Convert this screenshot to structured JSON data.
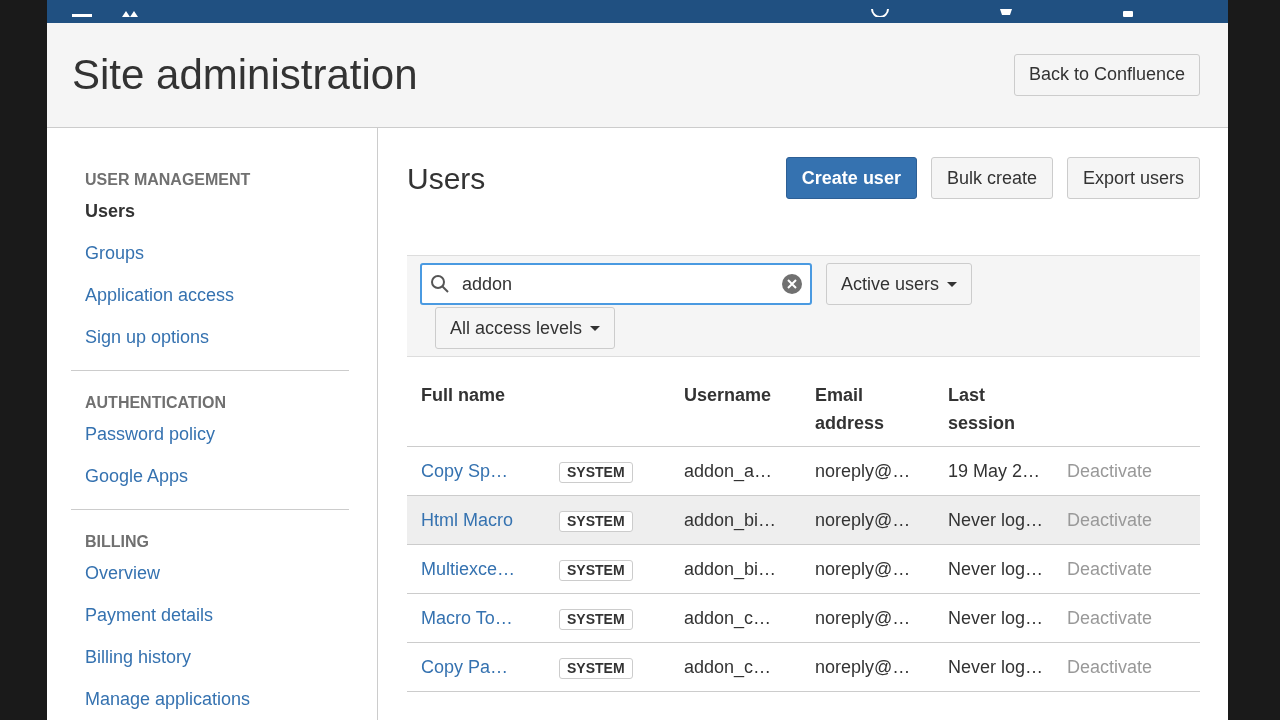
{
  "page_title": "Site administration",
  "back_button": "Back to Confluence",
  "sidebar": [
    {
      "heading": "USER MANAGEMENT",
      "items": [
        {
          "label": "Users",
          "selected": true
        },
        {
          "label": "Groups",
          "selected": false
        },
        {
          "label": "Application access",
          "selected": false
        },
        {
          "label": "Sign up options",
          "selected": false
        }
      ]
    },
    {
      "heading": "AUTHENTICATION",
      "items": [
        {
          "label": "Password policy",
          "selected": false
        },
        {
          "label": "Google Apps",
          "selected": false
        }
      ]
    },
    {
      "heading": "BILLING",
      "items": [
        {
          "label": "Overview",
          "selected": false
        },
        {
          "label": "Payment details",
          "selected": false
        },
        {
          "label": "Billing history",
          "selected": false
        },
        {
          "label": "Manage applications",
          "selected": false
        }
      ]
    }
  ],
  "section_title": "Users",
  "actions": [
    {
      "label": "Create user",
      "kind": "primary"
    },
    {
      "label": "Bulk create",
      "kind": "default"
    },
    {
      "label": "Export users",
      "kind": "default"
    }
  ],
  "search": {
    "value": "addon"
  },
  "filters": [
    "Active users",
    "All access levels"
  ],
  "table": {
    "columns": [
      "Full name",
      "",
      "Username",
      "Email address",
      "Last session",
      ""
    ],
    "rows": [
      {
        "name": "Copy Sp…",
        "badge": "SYSTEM",
        "username": "addon_a…",
        "email": "noreply@…",
        "last_session": "19 May 2…",
        "action": "Deactivate",
        "hovered": false
      },
      {
        "name": "Html Macro",
        "badge": "SYSTEM",
        "username": "addon_bi…",
        "email": "noreply@…",
        "last_session": "Never log…",
        "action": "Deactivate",
        "hovered": true
      },
      {
        "name": "Multiexce…",
        "badge": "SYSTEM",
        "username": "addon_bi…",
        "email": "noreply@…",
        "last_session": "Never log…",
        "action": "Deactivate",
        "hovered": false
      },
      {
        "name": "Macro To…",
        "badge": "SYSTEM",
        "username": "addon_c…",
        "email": "noreply@…",
        "last_session": "Never log…",
        "action": "Deactivate",
        "hovered": false
      },
      {
        "name": "Copy Pa…",
        "badge": "SYSTEM",
        "username": "addon_c…",
        "email": "noreply@…",
        "last_session": "Never log…",
        "action": "Deactivate",
        "hovered": false
      }
    ]
  }
}
